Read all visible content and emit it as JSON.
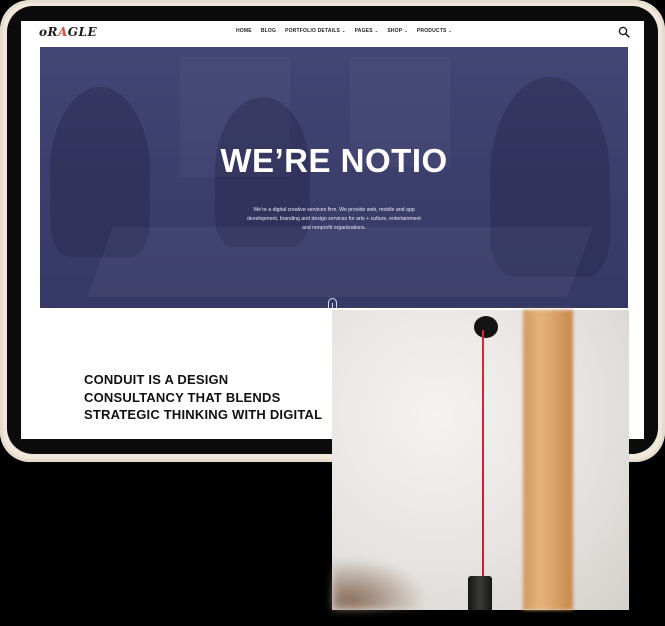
{
  "nav": {
    "logo_pre": "oR",
    "logo_accent": "A",
    "logo_post": "GLE",
    "items": [
      {
        "label": "HOME",
        "dropdown": false
      },
      {
        "label": "BLOG",
        "dropdown": false
      },
      {
        "label": "PORTFOLIO DETAILS",
        "dropdown": true
      },
      {
        "label": "PAGES",
        "dropdown": true
      },
      {
        "label": "SHOP",
        "dropdown": true
      },
      {
        "label": "PRODUCTS",
        "dropdown": true
      }
    ],
    "search_icon": "search-icon"
  },
  "hero": {
    "title": "WE’RE NOTIO",
    "description": "We’re a digital creative services firm. We provide web, mobile and app development, branding and design services for arts + culture, entertainment and nonprofit organizations.",
    "accent_color": "#3f4170"
  },
  "section": {
    "heading": "CONDUIT IS A DESIGN CONSULTANCY THAT BLENDS STRATEGIC THINKING WITH DIGITAL"
  },
  "colors": {
    "device_frame": "#f1e8dc",
    "hero_overlay": "#404271",
    "accent_red": "#d94b3b",
    "cord_red": "#d02a3c"
  }
}
